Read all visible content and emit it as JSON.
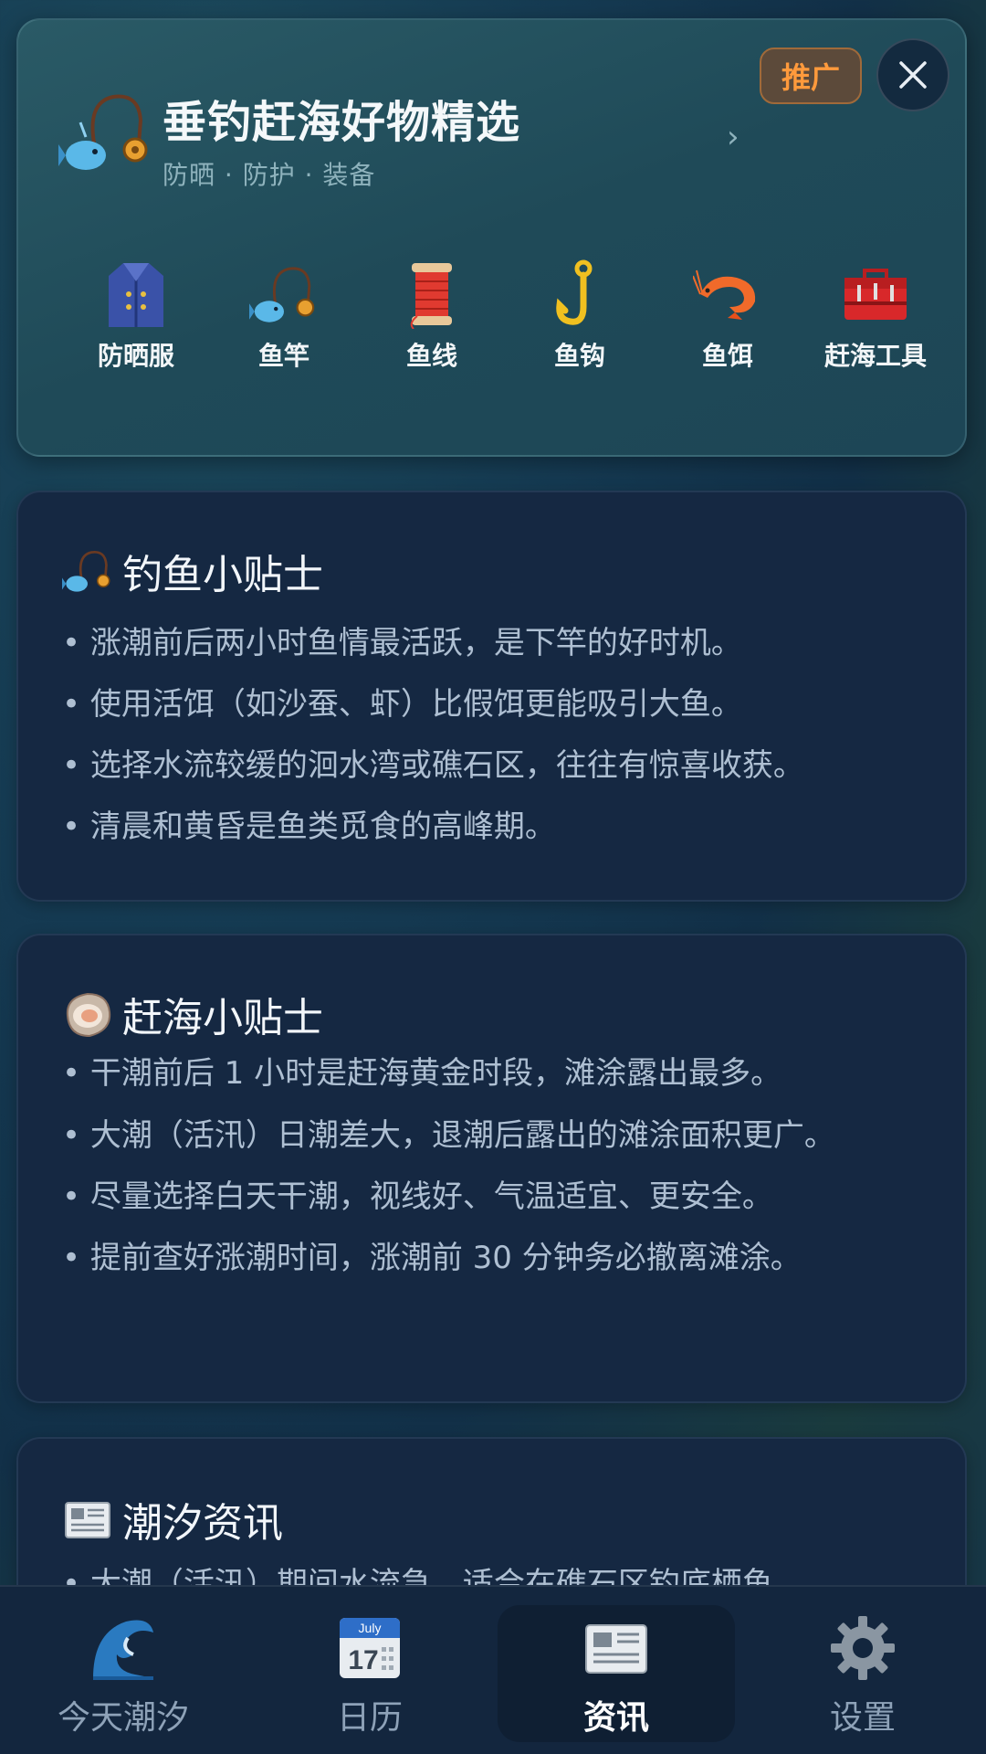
{
  "promo": {
    "title": "垂钓赶海好物精选",
    "subtitle": "防晒 · 防护 · 装备",
    "badge": "推广",
    "categories": [
      {
        "label": "防晒服",
        "icon": "coat-icon"
      },
      {
        "label": "鱼竿",
        "icon": "fishing-rod-icon"
      },
      {
        "label": "鱼线",
        "icon": "spool-thread-icon"
      },
      {
        "label": "鱼钩",
        "icon": "hook-icon"
      },
      {
        "label": "鱼饵",
        "icon": "shrimp-icon"
      },
      {
        "label": "赶海工具",
        "icon": "toolbox-icon"
      }
    ]
  },
  "fishing_tips": {
    "title": "钓鱼小贴士",
    "items": [
      "• 涨潮前后两小时鱼情最活跃，是下竿的好时机。",
      "• 使用活饵（如沙蚕、虾）比假饵更能吸引大鱼。",
      "• 选择水流较缓的洄水湾或礁石区，往往有惊喜收获。",
      "• 清晨和黄昏是鱼类觅食的高峰期。"
    ]
  },
  "beach_tips": {
    "title": "赶海小贴士",
    "items": [
      "• 干潮前后 1 小时是赶海黄金时段，滩涂露出最多。",
      "• 大潮（活汛）日潮差大，退潮后露出的滩涂面积更广。",
      "• 尽量选择白天干潮，视线好、气温适宜、更安全。",
      "• 提前查好涨潮时间，涨潮前 30 分钟务必撤离滩涂。"
    ]
  },
  "news": {
    "title": "潮汐资讯",
    "items": [
      "• 大潮（活汛）期间水流急，适合在礁石区钓底栖鱼。"
    ]
  },
  "nav": {
    "items": [
      {
        "label": "今天潮汐",
        "icon": "wave-icon"
      },
      {
        "label": "日历",
        "icon": "calendar-icon",
        "calendar_month": "July",
        "calendar_day": "17"
      },
      {
        "label": "资讯",
        "icon": "newspaper-icon",
        "active": true
      },
      {
        "label": "设置",
        "icon": "gear-icon"
      }
    ]
  }
}
